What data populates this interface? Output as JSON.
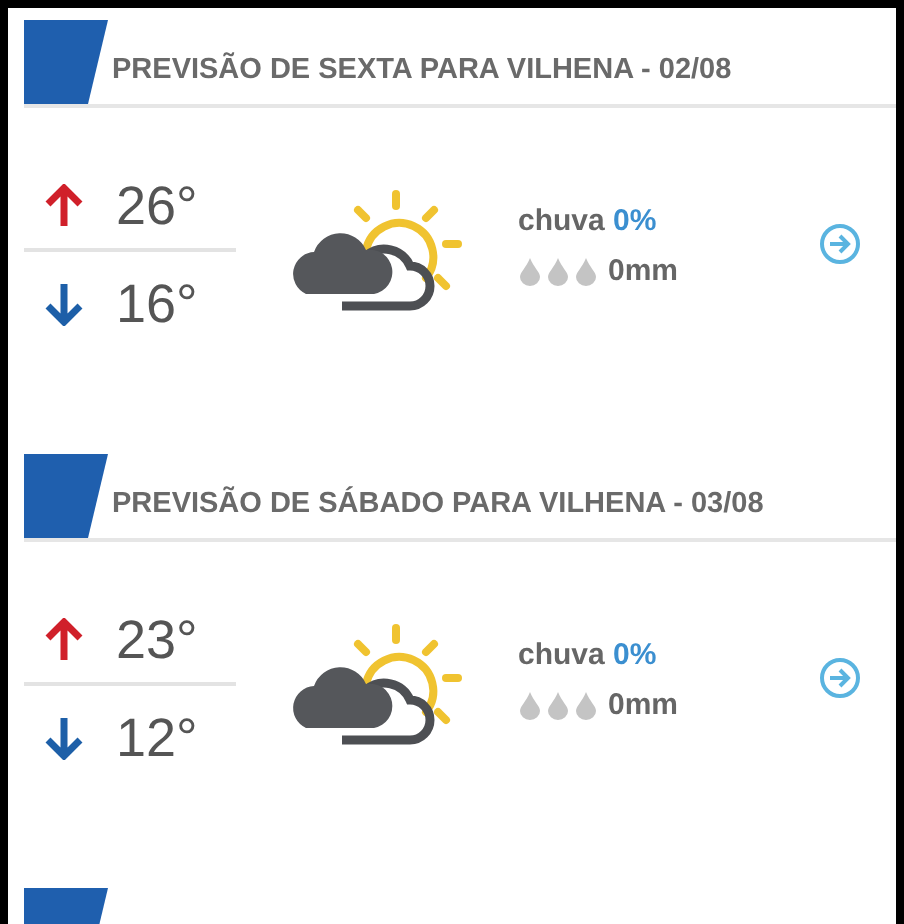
{
  "forecasts": [
    {
      "title": "PREVISÃO DE SEXTA PARA VILHENA - 02/08",
      "high": "26°",
      "low": "16°",
      "rain_label": "chuva",
      "rain_chance": "0%",
      "precipitation": "0mm"
    },
    {
      "title": "PREVISÃO DE SÁBADO PARA VILHENA - 03/08",
      "high": "23°",
      "low": "12°",
      "rain_label": "chuva",
      "rain_chance": "0%",
      "precipitation": "0mm"
    }
  ]
}
